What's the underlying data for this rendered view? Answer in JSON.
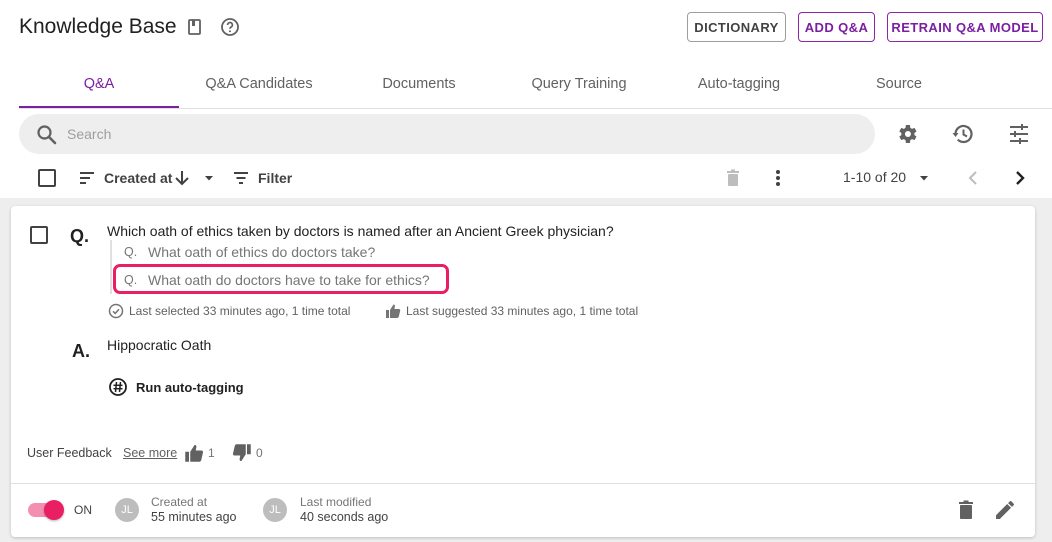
{
  "header": {
    "title": "Knowledge Base",
    "icons": [
      "book-icon",
      "help-circle-icon"
    ],
    "buttons": {
      "dictionary": "DICTIONARY",
      "add_qa": "ADD Q&A",
      "retrain": "RETRAIN Q&A MODEL"
    }
  },
  "tabs": [
    {
      "label": "Q&A",
      "active": true
    },
    {
      "label": "Q&A Candidates",
      "active": false
    },
    {
      "label": "Documents",
      "active": false
    },
    {
      "label": "Query Training",
      "active": false
    },
    {
      "label": "Auto-tagging",
      "active": false
    },
    {
      "label": "Source",
      "active": false
    }
  ],
  "search": {
    "placeholder": "Search",
    "value": ""
  },
  "toolbar": {
    "sort_label": "Created at",
    "filter_label": "Filter",
    "pagination": "1-10 of 20",
    "icons": [
      "settings-icon",
      "history-icon",
      "tune-icon",
      "sort-icon",
      "arrow-down-icon",
      "dropdown-icon",
      "filter-icon",
      "delete-icon",
      "more-vert-icon",
      "chevron-left-icon",
      "chevron-right-icon"
    ]
  },
  "item": {
    "q_prefix": "Q.",
    "a_prefix": "A.",
    "question": "Which oath of ethics taken by doctors is named after an Ancient Greek physician?",
    "alternatives": [
      {
        "prefix": "Q.",
        "text": "What oath of ethics do doctors take?"
      },
      {
        "prefix": "Q.",
        "text": "What oath do doctors have to take for ethics?"
      }
    ],
    "last_selected": "Last selected 33 minutes ago, 1 time total",
    "last_suggested": "Last suggested 33 minutes ago, 1 time total",
    "answer": "Hippocratic Oath",
    "auto_tag_label": "Run auto-tagging",
    "feedback": {
      "label": "User Feedback",
      "see_more": "See more",
      "thumbs_up": "1",
      "thumbs_down": "0"
    },
    "footer": {
      "toggle_label": "ON",
      "toggle_on": true,
      "created_avatar": "JL",
      "created_label": "Created at",
      "created_value": "55 minutes ago",
      "modified_avatar": "JL",
      "modified_label": "Last modified",
      "modified_value": "40 seconds ago"
    }
  },
  "colors": {
    "accent": "#7b1fa2",
    "highlight": "#e91e63",
    "toggle_track": "#f48fb1",
    "background": "#eeeeee"
  }
}
